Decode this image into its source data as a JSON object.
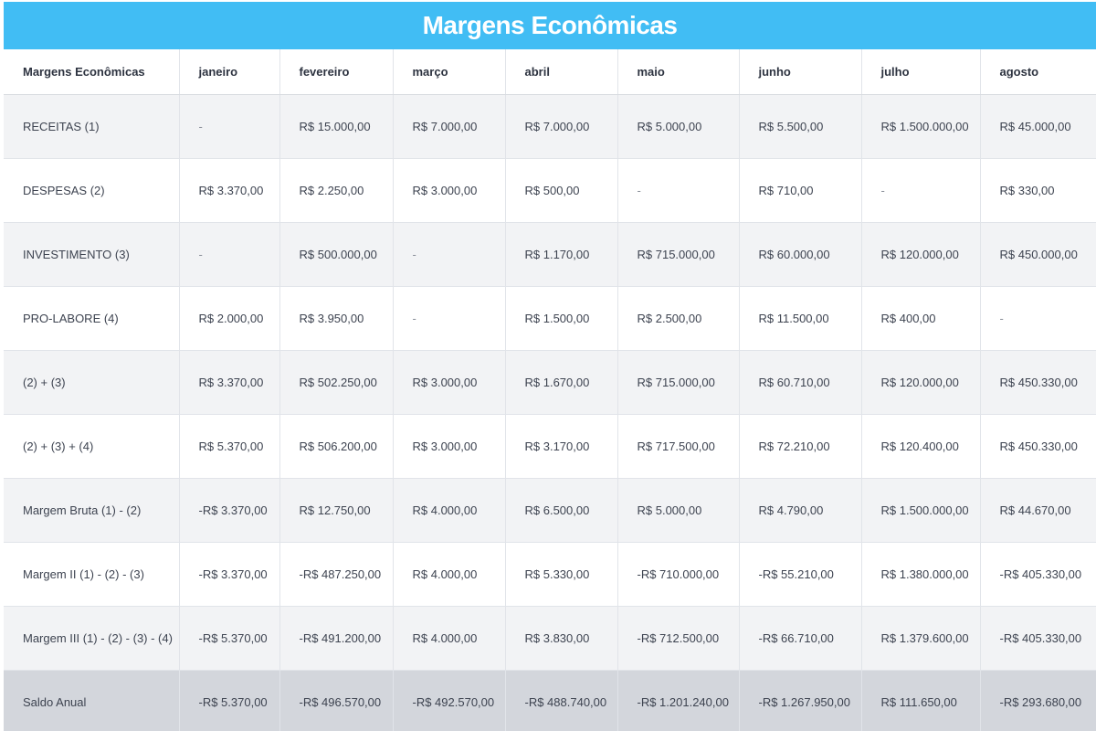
{
  "title": "Margens Econômicas",
  "table": {
    "headers": [
      "Margens Econômicas",
      "janeiro",
      "fevereiro",
      "março",
      "abril",
      "maio",
      "junho",
      "julho",
      "agosto"
    ],
    "rows": [
      [
        "RECEITAS (1)",
        "-",
        "R$ 15.000,00",
        "R$ 7.000,00",
        "R$ 7.000,00",
        "R$ 5.000,00",
        "R$ 5.500,00",
        "R$ 1.500.000,00",
        "R$ 45.000,00"
      ],
      [
        "DESPESAS (2)",
        "R$ 3.370,00",
        "R$ 2.250,00",
        "R$ 3.000,00",
        "R$ 500,00",
        "-",
        "R$ 710,00",
        "-",
        "R$ 330,00"
      ],
      [
        "INVESTIMENTO (3)",
        "-",
        "R$ 500.000,00",
        "-",
        "R$ 1.170,00",
        "R$ 715.000,00",
        "R$ 60.000,00",
        "R$ 120.000,00",
        "R$ 450.000,00"
      ],
      [
        "PRO-LABORE (4)",
        "R$ 2.000,00",
        "R$ 3.950,00",
        "-",
        "R$ 1.500,00",
        "R$ 2.500,00",
        "R$ 11.500,00",
        "R$ 400,00",
        "-"
      ],
      [
        "(2) + (3)",
        "R$ 3.370,00",
        "R$ 502.250,00",
        "R$ 3.000,00",
        "R$ 1.670,00",
        "R$ 715.000,00",
        "R$ 60.710,00",
        "R$ 120.000,00",
        "R$ 450.330,00"
      ],
      [
        "(2) + (3) + (4)",
        "R$ 5.370,00",
        "R$ 506.200,00",
        "R$ 3.000,00",
        "R$ 3.170,00",
        "R$ 717.500,00",
        "R$ 72.210,00",
        "R$ 120.400,00",
        "R$ 450.330,00"
      ],
      [
        "Margem Bruta (1) - (2)",
        "-R$ 3.370,00",
        "R$ 12.750,00",
        "R$ 4.000,00",
        "R$ 6.500,00",
        "R$ 5.000,00",
        "R$ 4.790,00",
        "R$ 1.500.000,00",
        "R$ 44.670,00"
      ],
      [
        "Margem II (1) - (2) - (3)",
        "-R$ 3.370,00",
        "-R$ 487.250,00",
        "R$ 4.000,00",
        "R$ 5.330,00",
        "-R$ 710.000,00",
        "-R$ 55.210,00",
        "R$ 1.380.000,00",
        "-R$ 405.330,00"
      ],
      [
        "Margem III (1) - (2) - (3) - (4)",
        "-R$ 5.370,00",
        "-R$ 491.200,00",
        "R$ 4.000,00",
        "R$ 3.830,00",
        "-R$ 712.500,00",
        "-R$ 66.710,00",
        "R$ 1.379.600,00",
        "-R$ 405.330,00"
      ],
      [
        "Saldo Anual",
        "-R$ 5.370,00",
        "-R$ 496.570,00",
        "-R$ 492.570,00",
        "-R$ 488.740,00",
        "-R$ 1.201.240,00",
        "-R$ 1.267.950,00",
        "R$ 111.650,00",
        "-R$ 293.680,00"
      ]
    ]
  }
}
